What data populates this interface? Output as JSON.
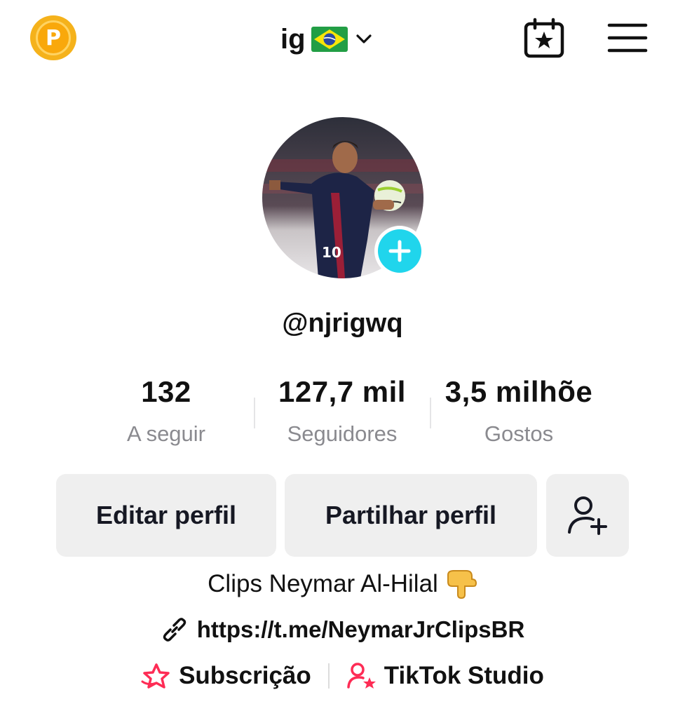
{
  "header": {
    "coin_letter": "P",
    "account_name": "ig",
    "flag_icon": "brazil-flag",
    "chevron_icon": "chevron-down-icon",
    "calendar_icon": "calendar-star-icon",
    "menu_icon": "hamburger-menu-icon"
  },
  "profile": {
    "username": "@njrigwq",
    "avatar_alt": "profile photo",
    "add_badge_icon": "plus-icon",
    "accent_color": "#20d5ec"
  },
  "stats": [
    {
      "value": "132",
      "label": "A seguir"
    },
    {
      "value": "127,7 mil",
      "label": "Seguidores"
    },
    {
      "value": "3,5 milhõe",
      "label": "Gostos"
    }
  ],
  "actions": {
    "edit_label": "Editar perfil",
    "share_label": "Partilhar perfil",
    "add_friend_icon": "add-user-icon"
  },
  "bio": {
    "text": "Clips Neymar Al-Hilal",
    "emoji": "👇"
  },
  "link": {
    "icon": "link-icon",
    "url": "https://t.me/NeymarJrClipsBR"
  },
  "bottom_links": [
    {
      "label": "Subscrição",
      "icon": "subscription-star-icon",
      "color": "#fe2c55"
    },
    {
      "label": "TikTok Studio",
      "icon": "studio-user-star-icon",
      "color": "#fe2c55"
    }
  ]
}
